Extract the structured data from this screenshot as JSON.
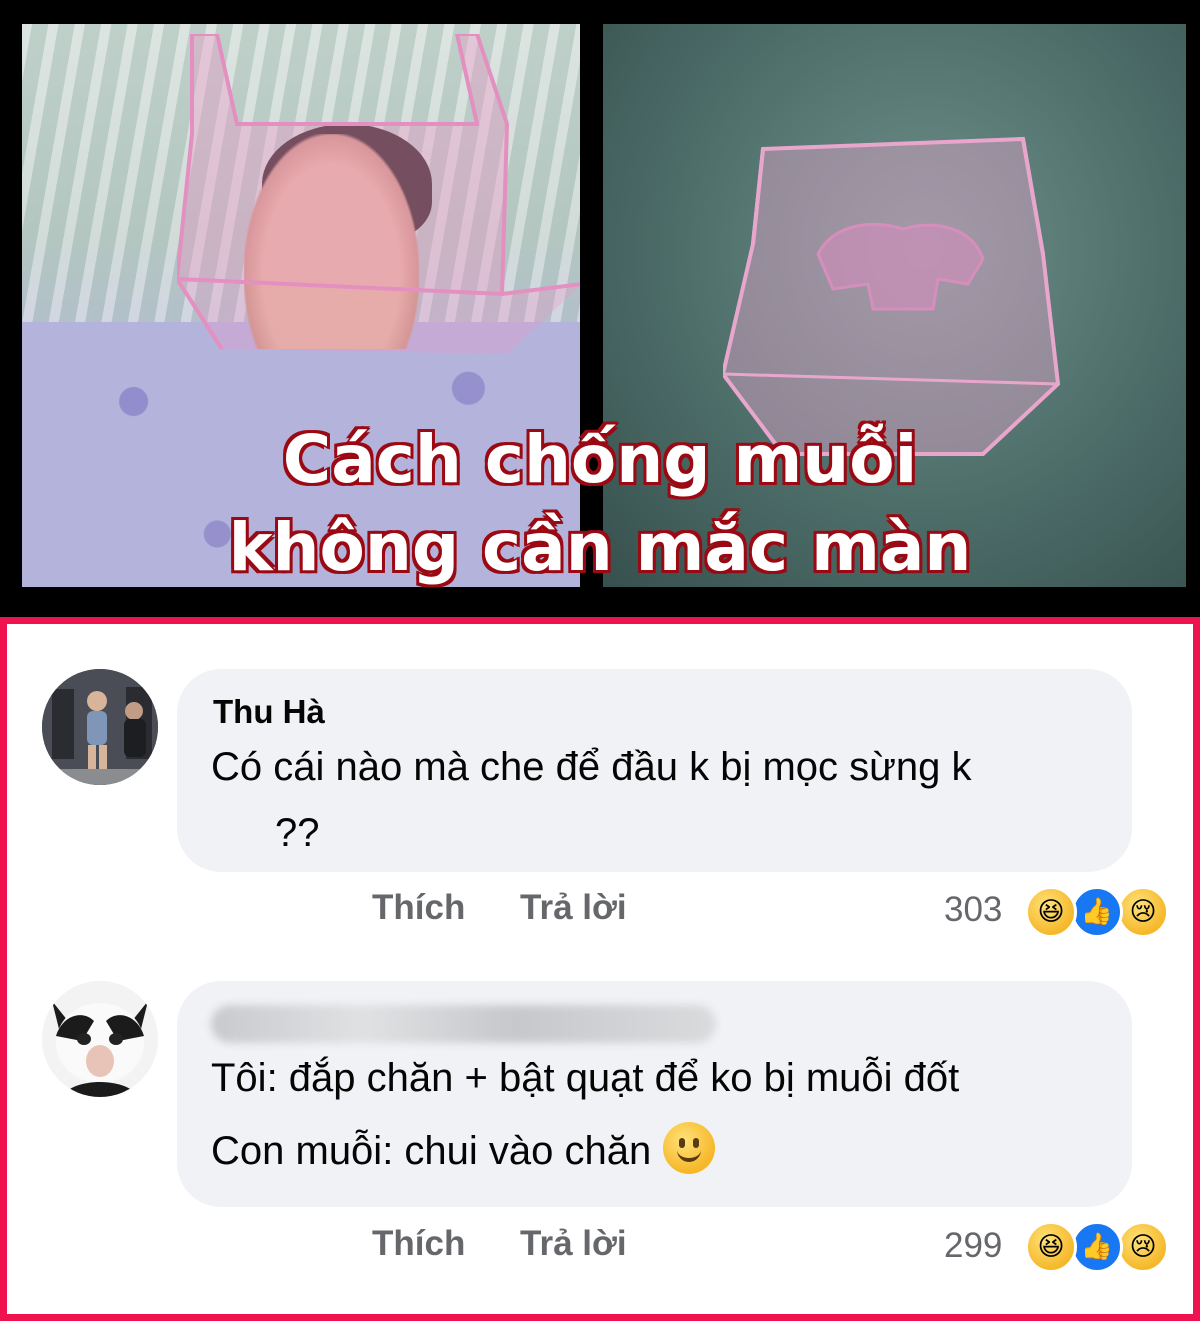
{
  "meme": {
    "headline_line1": "Cách chống muỗi",
    "headline_line2": "không cần mắc màn"
  },
  "comments": [
    {
      "author": "Thu Hà",
      "text_line1": "Có cái nào mà che để đầu k bị mọc sừng k",
      "text_line2": "??",
      "like_label": "Thích",
      "reply_label": "Trả lời",
      "reaction_count": "303",
      "reactions": [
        "haha-icon",
        "like-icon",
        "sad-icon"
      ]
    },
    {
      "author": "",
      "text_line1": "Tôi: đắp chăn + bật quạt để ko bị muỗi đốt",
      "text_line2": "Con muỗi: chui vào chăn",
      "like_label": "Thích",
      "reply_label": "Trả lời",
      "reaction_count": "299",
      "reactions": [
        "haha-icon",
        "like-icon",
        "sad-icon"
      ]
    }
  ],
  "colors": {
    "panel_border": "#f0124f",
    "headline_stroke": "#9b0a14",
    "bubble_bg": "#f0f2f5",
    "meta_text": "#65676b"
  }
}
